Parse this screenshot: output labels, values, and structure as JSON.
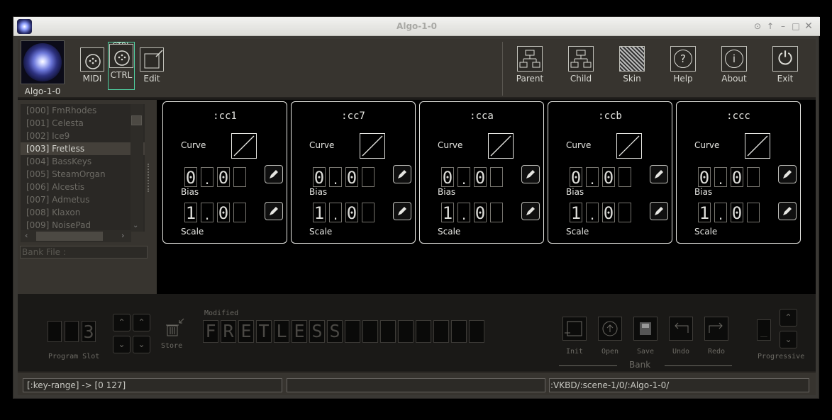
{
  "window": {
    "title": "Algo-1-0"
  },
  "toolbar": {
    "logo_label": "Algo-1-0",
    "left_tools": [
      {
        "label": "MIDI",
        "icon": "midi-connector-icon"
      },
      {
        "label": "CTRL",
        "icon": "midi-controller-icon",
        "badge": "CTRL",
        "active": true
      },
      {
        "label": "Edit",
        "icon": "edit-window-icon"
      }
    ],
    "right_tools": [
      {
        "label": "Parent",
        "icon": "tree-up-icon"
      },
      {
        "label": "Child",
        "icon": "tree-down-icon"
      },
      {
        "label": "Skin",
        "icon": "skin-pattern-icon"
      },
      {
        "label": "Help",
        "icon": "help-icon",
        "glyph": "?"
      },
      {
        "label": "About",
        "icon": "info-icon",
        "glyph": "i"
      },
      {
        "label": "Exit",
        "icon": "power-icon",
        "glyph": "⏻"
      }
    ]
  },
  "program_list": {
    "items": [
      "[000] FmRhodes",
      "[001] Celesta",
      "[002] Ice9",
      "[003] Fretless",
      "[004] BassKeys",
      "[005] SteamOrgan",
      "[006] Alcestis",
      "[007] Admetus",
      "[008] Klaxon",
      "[009] NoisePad"
    ],
    "selected_index": 3,
    "bank_file_label": "Bank File :"
  },
  "controllers": [
    {
      "name": ":cc1",
      "curve_label": "Curve",
      "bias_label": "Bias",
      "scale_label": "Scale",
      "bias": [
        "0",
        ".",
        "0",
        ""
      ],
      "scale": [
        "1",
        ".",
        "0",
        ""
      ]
    },
    {
      "name": ":cc7",
      "curve_label": "Curve",
      "bias_label": "Bias",
      "scale_label": "Scale",
      "bias": [
        "0",
        ".",
        "0",
        ""
      ],
      "scale": [
        "1",
        ".",
        "0",
        ""
      ]
    },
    {
      "name": ":cca",
      "curve_label": "Curve",
      "bias_label": "Bias",
      "scale_label": "Scale",
      "bias": [
        "0",
        ".",
        "0",
        ""
      ],
      "scale": [
        "1",
        ".",
        "0",
        ""
      ]
    },
    {
      "name": ":ccb",
      "curve_label": "Curve",
      "bias_label": "Bias",
      "scale_label": "Scale",
      "bias": [
        "0",
        ".",
        "0",
        ""
      ],
      "scale": [
        "1",
        ".",
        "0",
        ""
      ]
    },
    {
      "name": ":ccc",
      "curve_label": "Curve",
      "bias_label": "Bias",
      "scale_label": "Scale",
      "bias": [
        "0",
        ".",
        "0",
        ""
      ],
      "scale": [
        "1",
        ".",
        "0",
        ""
      ]
    }
  ],
  "program": {
    "slot_digits": [
      "",
      "",
      "3"
    ],
    "slot_label": "Program Slot",
    "store_label": "Store",
    "modified_label": "Modified",
    "name_chars": [
      "F",
      "R",
      "E",
      "T",
      "L",
      "E",
      "S",
      "S",
      "",
      "",
      "",
      "",
      "",
      "",
      "",
      ""
    ]
  },
  "bank": {
    "label": "Bank",
    "buttons": [
      "Init",
      "Open",
      "Save",
      "Undo",
      "Redo"
    ],
    "progressive_label": "Progressive",
    "progressive_value": "_"
  },
  "status": {
    "left": "[:key-range] -> [0 127]",
    "middle": "",
    "right": ":VKBD/:scene-1/0/:Algo-1-0/"
  }
}
